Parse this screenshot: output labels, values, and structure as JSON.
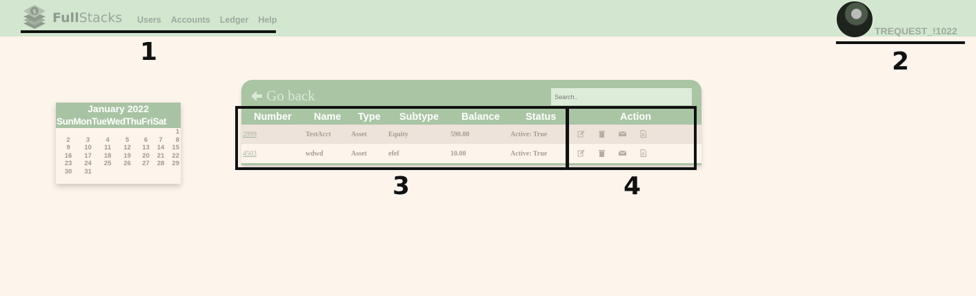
{
  "nav": {
    "logo_text_bold": "Full",
    "logo_text_light": "Stacks",
    "links": [
      "Users",
      "Accounts",
      "Ledger",
      "Help"
    ]
  },
  "user": {
    "username": "TREQUEST_!1022"
  },
  "annotations": {
    "n1": "1",
    "n2": "2",
    "n3": "3",
    "n4": "4"
  },
  "calendar": {
    "title": "January 2022",
    "days": [
      "Sun",
      "Mon",
      "Tue",
      "Wed",
      "Thu",
      "Fri",
      "Sat"
    ],
    "weeks": [
      [
        "",
        "",
        "",
        "",
        "",
        "",
        "1"
      ],
      [
        "2",
        "3",
        "4",
        "5",
        "6",
        "7",
        "8"
      ],
      [
        "9",
        "10",
        "11",
        "12",
        "13",
        "14",
        "15"
      ],
      [
        "16",
        "17",
        "18",
        "19",
        "20",
        "21",
        "22"
      ],
      [
        "23",
        "24",
        "25",
        "26",
        "27",
        "28",
        "29"
      ],
      [
        "30",
        "31",
        "",
        "",
        "",
        "",
        ""
      ]
    ]
  },
  "panel": {
    "go_back_label": "Go back",
    "search_placeholder": "Search..",
    "columns": [
      "Number",
      "Name",
      "Type",
      "Subtype",
      "Balance",
      "Status",
      "Action"
    ],
    "rows": [
      {
        "number": "2999",
        "name": "TestAcct",
        "type": "Asset",
        "subtype": "Equity",
        "balance": "590.00",
        "status": "Active: True"
      },
      {
        "number": "4503",
        "name": "wdwd",
        "type": "Asset",
        "subtype": "efef",
        "balance": "10.00",
        "status": "Active: True"
      }
    ],
    "action_icons": [
      "edit-icon",
      "trash-icon",
      "envelope-icon",
      "pdf-icon"
    ]
  },
  "colors": {
    "topbar": "#d3e6cf",
    "accent": "#a9c5a4",
    "background": "#fdf4ec"
  }
}
